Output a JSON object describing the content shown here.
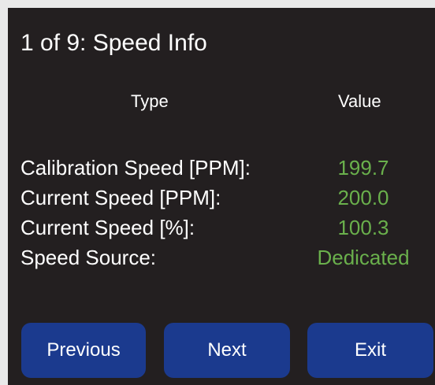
{
  "header": {
    "title": "1 of 9: Speed Info"
  },
  "columns": {
    "type_label": "Type",
    "value_label": "Value"
  },
  "rows": [
    {
      "label": "Calibration Speed [PPM]:",
      "value": "199.7"
    },
    {
      "label": "Current Speed [PPM]:",
      "value": "200.0"
    },
    {
      "label": "Current Speed [%]:",
      "value": "100.3"
    },
    {
      "label": "Speed Source:",
      "value": "Dedicated"
    }
  ],
  "buttons": {
    "previous_label": "Previous",
    "next_label": "Next",
    "exit_label": "Exit"
  },
  "colors": {
    "background": "#231f20",
    "value_text": "#6ab04c",
    "button": "#1b3a8e"
  }
}
